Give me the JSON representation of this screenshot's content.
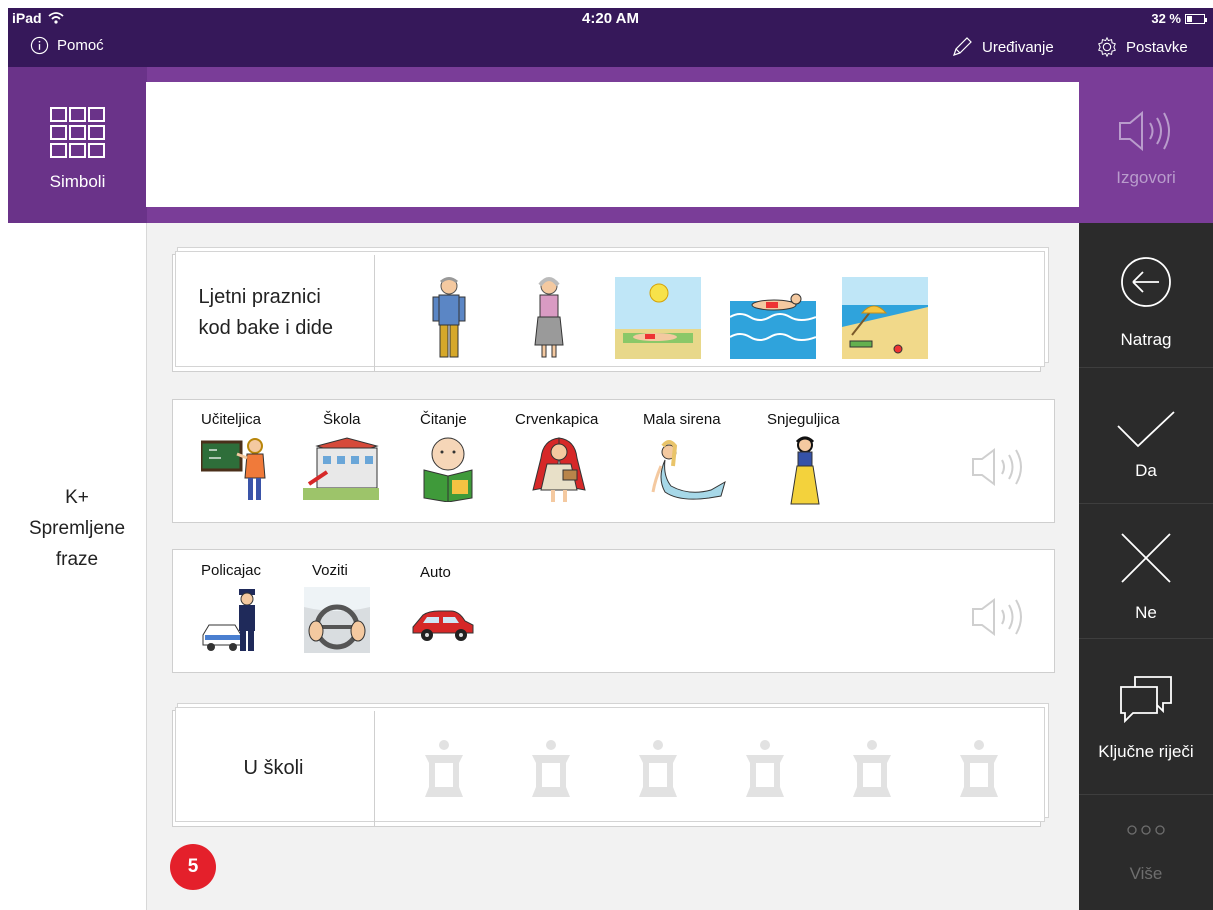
{
  "status_bar": {
    "device": "iPad",
    "time": "4:20 AM",
    "battery": "32 %"
  },
  "top_bar": {
    "help_label": "Pomoć",
    "edit_label": "Uređivanje",
    "settings_label": "Postavke"
  },
  "symbols_button": {
    "label": "Simboli",
    "icon": "grid-icon"
  },
  "speak_button": {
    "label": "Izgovori",
    "icon": "speaker-icon"
  },
  "left_panel": {
    "line1": "K+",
    "line2": "Spremljene",
    "line3": "fraze"
  },
  "cards": [
    {
      "title_line1": "Ljetni praznici",
      "title_line2": "kod bake i dide",
      "stacked": true,
      "symbols": [
        "grandfather",
        "grandmother",
        "sunbathing",
        "swimming",
        "beach"
      ]
    },
    {
      "words": [
        "Učiteljica",
        "Škola",
        "Čitanje",
        "Crvenkapica",
        "Mala sirena",
        "Snjeguljica"
      ]
    },
    {
      "words": [
        "Policajac",
        "Voziti",
        "Auto"
      ]
    },
    {
      "title": "U školi",
      "stacked": true,
      "placeholder_count": 6
    }
  ],
  "sidebar": {
    "back_label": "Natrag",
    "yes_label": "Da",
    "no_label": "Ne",
    "keywords_label": "Ključne riječi",
    "more_label": "Više"
  },
  "badge": "5",
  "colors": {
    "status_bar": "#36185a",
    "purple": "#7a3d98",
    "sidebar": "#2b2b2b",
    "badge": "#e4202b"
  }
}
